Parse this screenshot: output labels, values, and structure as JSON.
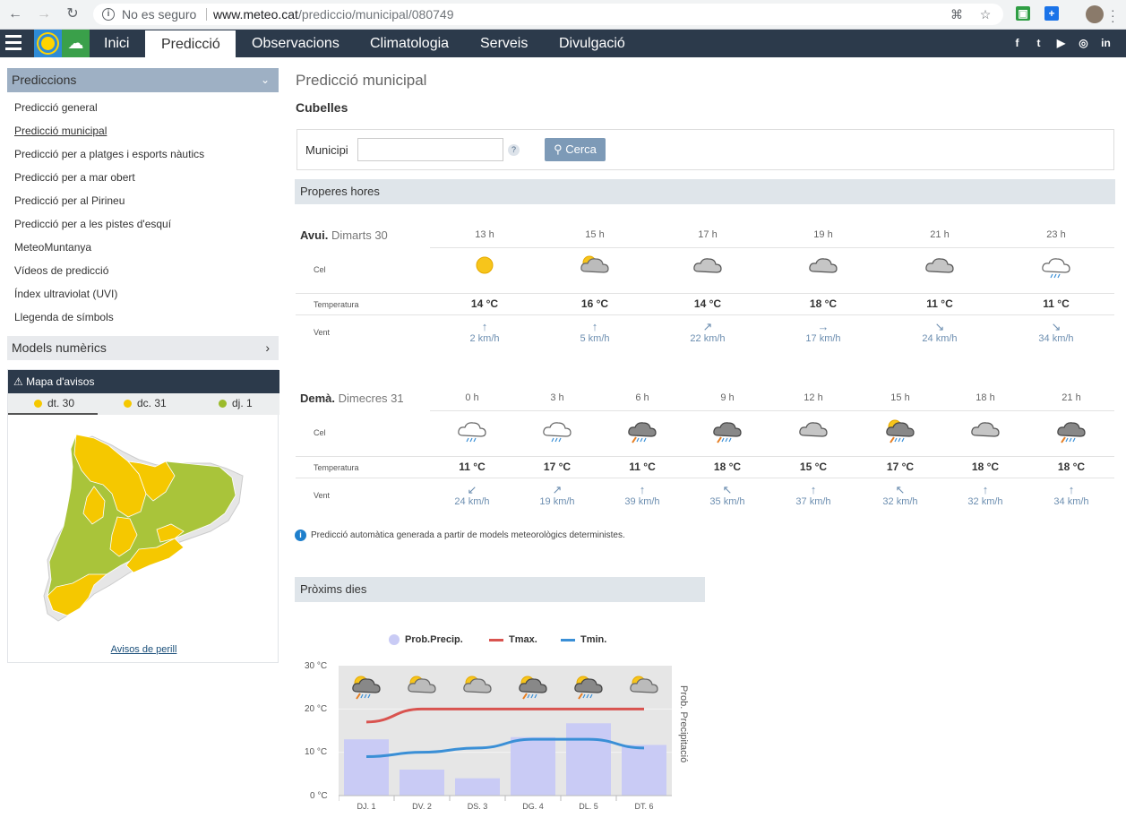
{
  "browser": {
    "security_text": "No es seguro",
    "url_host": "www.meteo.cat",
    "url_path": "/prediccio/municipal/080749"
  },
  "nav": {
    "items": [
      "Inici",
      "Predicció",
      "Observacions",
      "Climatologia",
      "Serveis",
      "Divulgació"
    ],
    "active": "Predicció",
    "social": [
      "f",
      "t",
      "▶",
      "◎",
      "in"
    ]
  },
  "sidebar": {
    "header": "Prediccions",
    "links": [
      "Predicció general",
      "Predicció municipal",
      "Predicció per a platges i esports nàutics",
      "Predicció per a mar obert",
      "Predicció per al Pirineu",
      "Predicció per a les pistes d'esquí",
      "MeteoMuntanya",
      "Vídeos de predicció",
      "Índex ultraviolat (UVI)",
      "Llegenda de símbols"
    ],
    "current": "Predicció municipal",
    "models_header": "Models numèrics",
    "avisos": {
      "title": "Mapa d'avisos",
      "tabs": [
        {
          "label": "dt. 30",
          "color": "#f5c800"
        },
        {
          "label": "dc. 31",
          "color": "#f5c800"
        },
        {
          "label": "dj. 1",
          "color": "#9bbb2b"
        }
      ],
      "link": "Avisos de perill"
    }
  },
  "main": {
    "title": "Predicció municipal",
    "city": "Cubelles",
    "search": {
      "label": "Municipi",
      "help": "?",
      "button": "Cerca"
    },
    "next_hours_header": "Properes hores",
    "row_labels": {
      "sky": "Cel",
      "temp": "Temperatura",
      "wind": "Vent"
    },
    "today": {
      "day": "Avui.",
      "date": "Dimarts 30",
      "hours": [
        "13 h",
        "15 h",
        "17 h",
        "19 h",
        "21 h",
        "23 h"
      ],
      "icons": [
        "sun",
        "sun-cloud",
        "cloud",
        "cloud",
        "cloud",
        "cloud-rain"
      ],
      "temps": [
        "14 °C",
        "16 °C",
        "14 °C",
        "18 °C",
        "11 °C",
        "11 °C"
      ],
      "wind_dirs": [
        "↑",
        "↑",
        "↗",
        "→",
        "↘",
        "↘"
      ],
      "winds": [
        "2 km/h",
        "5 km/h",
        "22 km/h",
        "17 km/h",
        "24 km/h",
        "34 km/h"
      ]
    },
    "tomorrow": {
      "day": "Demà.",
      "date": "Dimecres 31",
      "hours": [
        "0 h",
        "3 h",
        "6 h",
        "9 h",
        "12 h",
        "15 h",
        "18 h",
        "21 h"
      ],
      "icons": [
        "cloud-rain",
        "cloud-rain",
        "storm",
        "storm",
        "cloud",
        "sun-storm",
        "cloud",
        "storm"
      ],
      "temps": [
        "11 °C",
        "17 °C",
        "11 °C",
        "18 °C",
        "15 °C",
        "17 °C",
        "18 °C",
        "18 °C"
      ],
      "wind_dirs": [
        "↙",
        "↗",
        "↑",
        "↖",
        "↑",
        "↖",
        "↑",
        "↑"
      ],
      "winds": [
        "24 km/h",
        "19 km/h",
        "39 km/h",
        "35 km/h",
        "37 km/h",
        "32 km/h",
        "32 km/h",
        "34 km/h"
      ]
    },
    "note": "Predicció automàtica generada a partir de models meteorològics deterministes.",
    "next_days_header": "Pròxims dies"
  },
  "chart_data": {
    "type": "bar",
    "categories": [
      "DJ. 1",
      "DV. 2",
      "DS. 3",
      "DG. 4",
      "DL. 5",
      "DT. 6"
    ],
    "legend": [
      "Prob.Precip.",
      "Tmax.",
      "Tmin."
    ],
    "series": [
      {
        "name": "Prob.Precip.",
        "type": "bar",
        "values": [
          13,
          6,
          4,
          13.5,
          16.7,
          11.7
        ]
      },
      {
        "name": "Tmax.",
        "type": "line",
        "color": "#d9534f",
        "values": [
          17,
          20,
          20,
          20,
          20,
          20
        ]
      },
      {
        "name": "Tmin.",
        "type": "line",
        "color": "#3a8fd6",
        "values": [
          9,
          10,
          11,
          13,
          13,
          11
        ]
      }
    ],
    "icons": [
      "sun-storm",
      "sun-cloud",
      "sun-cloud",
      "sun-storm",
      "sun-storm",
      "sun-cloud"
    ],
    "y_ticks": [
      "30 °C",
      "20 °C",
      "10 °C",
      "0 °C"
    ],
    "ylim": [
      0,
      30
    ],
    "ylabel_right": "Prob. Precipitació",
    "legend_position": "top"
  }
}
